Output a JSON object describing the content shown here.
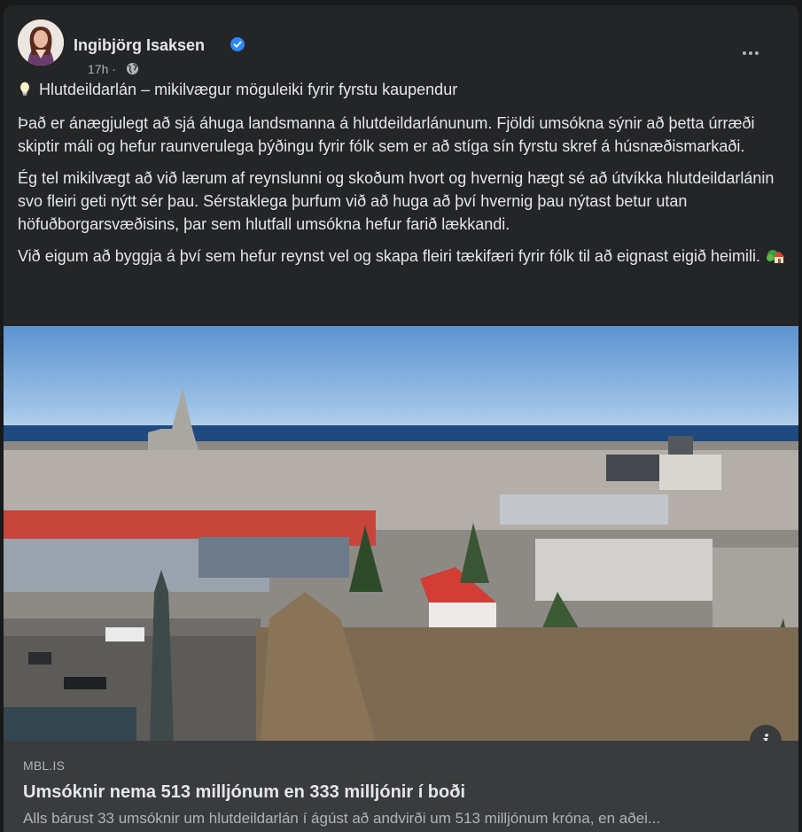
{
  "post": {
    "author": "Ingibjörg Isaksen",
    "time": "17h",
    "separator": "·",
    "visibility_icon": "globe-icon",
    "headline": "Hlutdeildarlán – mikilvægur möguleiki fyrir fyrstu kaupendur",
    "paragraphs": [
      "Það er ánægjulegt að sjá áhuga landsmanna á hlutdeildarlánunum. Fjöldi umsókna sýnir að þetta úrræði skiptir máli og hefur raunverulega þýðingu fyrir fólk sem er að stíga sín fyrstu skref á húsnæðismarkaði.",
      "Ég tel mikilvægt að við lærum af reynslunni og skoðum hvort og hvernig hægt sé að útvíkka hlutdeildarlánin svo fleiri geti nýtt sér þau. Sérstaklega þurfum við að huga að því hvernig þau nýtast betur utan höfuðborgarsvæðisins, þar sem hlutfall umsókna hefur farið lækkandi.",
      "Við eigum að byggja á því sem hefur reynst vel og skapa fleiri tækifæri fyrir fólk til að eignast eigið heimili."
    ]
  },
  "link": {
    "domain": "MBL.IS",
    "title": "Umsóknir nema 513 milljónum en 333 milljónir í boði",
    "description": "Alls bárust 33 umsóknir um hlutdeildarlán í ágúst að andvirði um 513 milljónum króna, en aðei...",
    "info_label": "i"
  },
  "colors": {
    "card_bg": "#242526",
    "footer_bg": "#3a3b3c",
    "verified_blue": "#2d88ff",
    "text_primary": "#e4e6eb",
    "text_secondary": "#b0b3b8"
  }
}
